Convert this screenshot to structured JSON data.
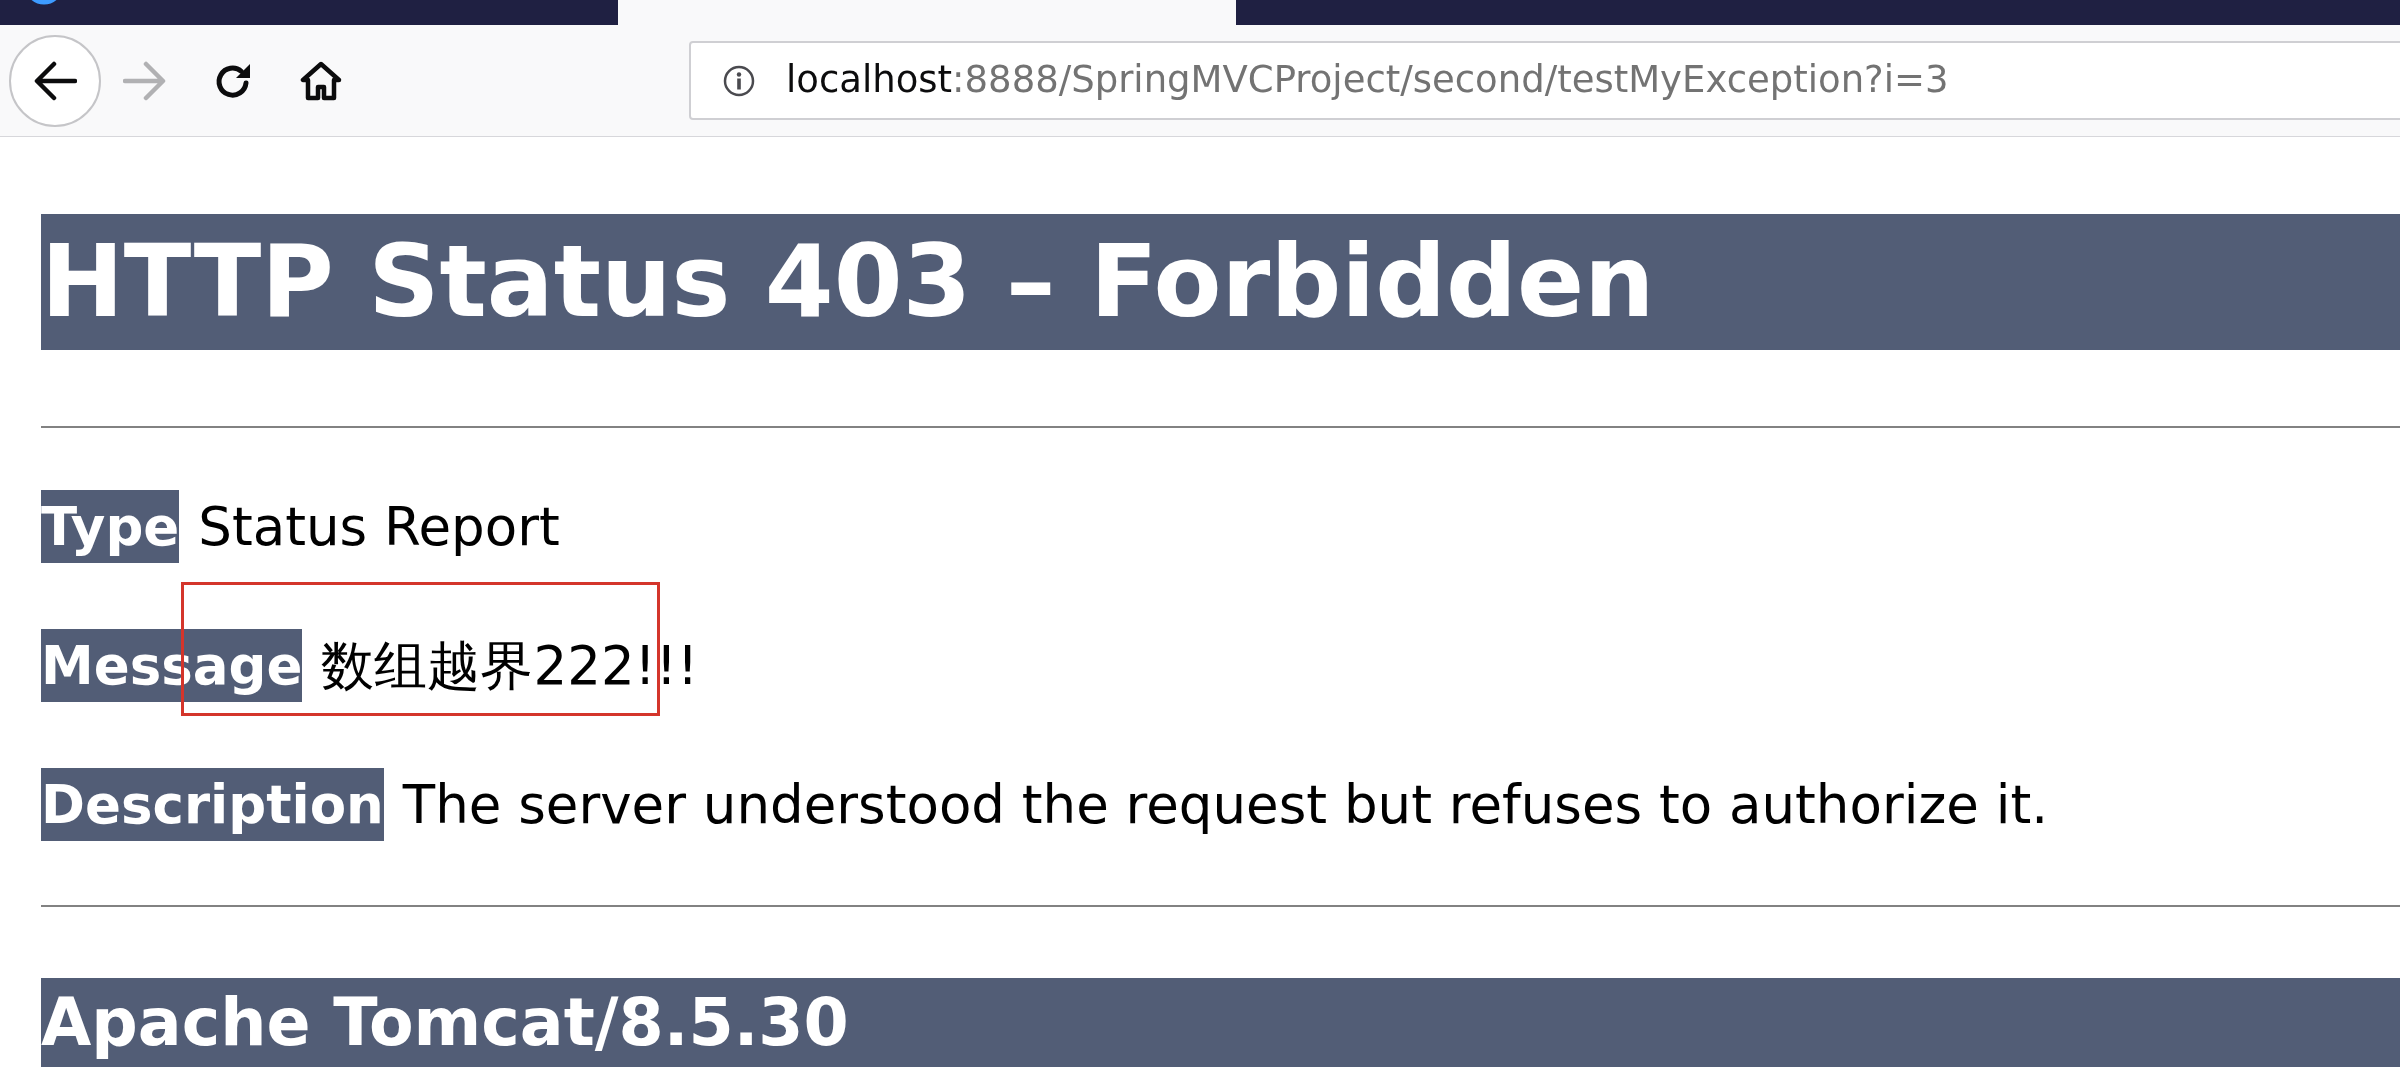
{
  "tab_strip": {
    "tabs": [
      {
        "selected": false
      },
      {
        "selected": true
      }
    ]
  },
  "toolbar": {
    "back": {
      "disabled": false
    },
    "forward": {
      "disabled": true
    },
    "address": {
      "host": "localhost",
      "path": ":8888/SpringMVCProject/second/testMyException?i=3"
    }
  },
  "page": {
    "title": "HTTP Status 403 – Forbidden",
    "fields": [
      {
        "label": "Type",
        "value": "Status Report",
        "annotated": false
      },
      {
        "label": "Message",
        "value": "数组越界222!!!",
        "annotated": true
      },
      {
        "label": "Description",
        "value": "The server understood the request but refuses to authorize it.",
        "annotated": false
      }
    ],
    "footer": "Apache Tomcat/8.5.30"
  }
}
